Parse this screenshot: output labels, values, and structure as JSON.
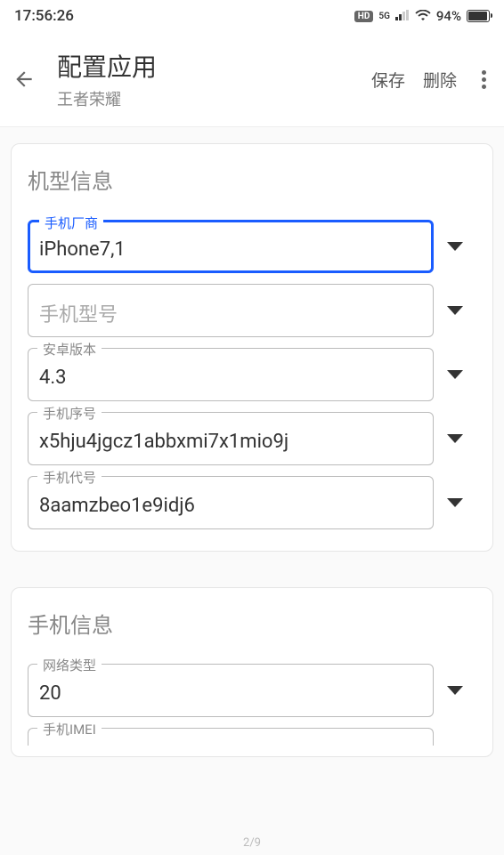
{
  "status_bar": {
    "time": "17:56:26",
    "hd": "HD",
    "network": "5G",
    "battery_percent": "94%"
  },
  "header": {
    "title": "配置应用",
    "subtitle": "王者荣耀",
    "save_label": "保存",
    "delete_label": "删除"
  },
  "section1": {
    "title": "机型信息",
    "fields": [
      {
        "label": "手机厂商",
        "value": "iPhone7,1"
      },
      {
        "label": "",
        "placeholder": "手机型号"
      },
      {
        "label": "安卓版本",
        "value": "4.3"
      },
      {
        "label": "手机序号",
        "value": "x5hju4jgcz1abbxmi7x1mio9j"
      },
      {
        "label": "手机代号",
        "value": "8aamzbeo1e9idj6"
      }
    ]
  },
  "section2": {
    "title": "手机信息",
    "fields": [
      {
        "label": "网络类型",
        "value": "20"
      },
      {
        "label": "手机IMEI",
        "value": ""
      }
    ]
  },
  "page_indicator": "2/9"
}
